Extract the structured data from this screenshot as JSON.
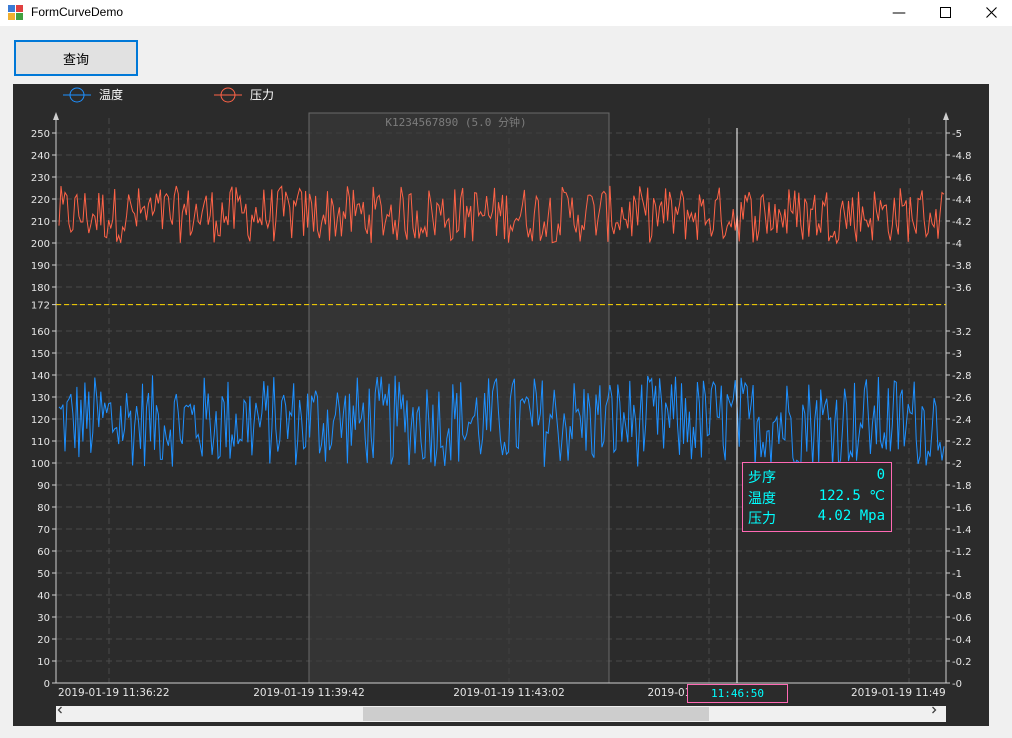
{
  "window": {
    "title": "FormCurveDemo",
    "minimize_symbol": "—",
    "maximize_icon": "maximize-icon",
    "close_icon": "close-icon"
  },
  "toolbar": {
    "query_label": "查询"
  },
  "chart": {
    "legend": [
      {
        "name": "温度",
        "color": "#1e90ff"
      },
      {
        "name": "压力",
        "color": "#ff6347"
      }
    ],
    "selection_label": "K1234567890 (5.0 分钟)",
    "left_ticks": [
      "250",
      "240",
      "230",
      "220",
      "210",
      "200",
      "190",
      "180",
      "172",
      "160",
      "150",
      "140",
      "130",
      "120",
      "110",
      "100",
      "90",
      "80",
      "70",
      "60",
      "50",
      "40",
      "30",
      "20",
      "10",
      "0"
    ],
    "right_ticks": [
      "5",
      "4.8",
      "4.6",
      "4.4",
      "4.2",
      "4",
      "3.8",
      "3.6",
      "3.2",
      "3",
      "2.8",
      "2.6",
      "2.4",
      "2.2",
      "2",
      "1.8",
      "1.6",
      "1.4",
      "1.2",
      "1",
      "0.8",
      "0.6",
      "0.4",
      "0.2",
      "0"
    ],
    "x_labels": [
      "2019-01-19 11:36:22",
      "2019-01-19 11:39:42",
      "2019-01-19 11:43:02",
      "2019-01-19",
      "2019-01-19 11:49"
    ],
    "reference_line": 172,
    "cursor_time": "11:46:50",
    "tooltip": {
      "step_label": "步序",
      "step_value": "0",
      "temp_label": "温度",
      "temp_value": "122.5 ℃",
      "pressure_label": "压力",
      "pressure_value": "4.02 Mpa"
    }
  },
  "chart_data": {
    "type": "line",
    "title": "",
    "xlabel": "",
    "ylabel": "",
    "x_start": "2019-01-19 11:36:22",
    "x_tick_labels": [
      "2019-01-19 11:36:22",
      "2019-01-19 11:39:42",
      "2019-01-19 11:43:02",
      "2019-01-19",
      "2019-01-19 11:49"
    ],
    "ylim_left": [
      0,
      250
    ],
    "ylim_right": [
      0,
      5
    ],
    "series": [
      {
        "name": "温度",
        "axis": "left",
        "unit": "℃",
        "color": "#1e90ff",
        "approx_range": [
          98,
          140
        ],
        "mean": 120
      },
      {
        "name": "压力",
        "axis": "right",
        "unit": "Mpa",
        "color": "#ff6347",
        "approx_range": [
          4.0,
          4.52
        ],
        "mean": 4.24
      }
    ],
    "reference_line": {
      "axis": "left",
      "value": 172,
      "color": "#ffd700",
      "style": "dashed"
    },
    "selection": {
      "label": "K1234567890 (5.0 分钟)",
      "from": "2019-01-19 11:39:42"
    },
    "cursor": {
      "time": "11:46:50",
      "step": 0,
      "temperature": 122.5,
      "pressure": 4.02
    },
    "grid": true,
    "legend_position": "top-left"
  }
}
